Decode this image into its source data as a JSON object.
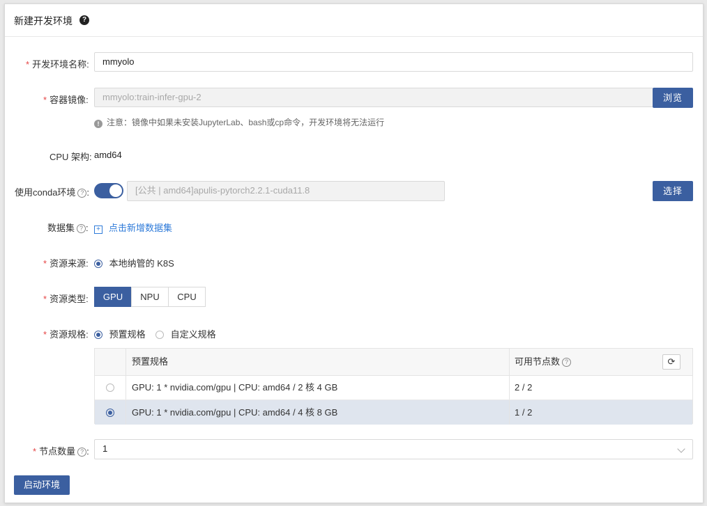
{
  "header": {
    "title": "新建开发环境",
    "help": "?"
  },
  "env_name": {
    "label": "开发环境名称:",
    "value": "mmyolo"
  },
  "image": {
    "label": "容器镜像:",
    "value": "mmyolo:train-infer-gpu-2",
    "browse_label": "浏览",
    "note": "注意：镜像中如果未安装JupyterLab、bash或cp命令，开发环境将无法运行"
  },
  "cpu_arch": {
    "label": "CPU 架构:",
    "value": "amd64"
  },
  "conda": {
    "label": "使用conda环境",
    "enabled": true,
    "value": "[公共 | amd64]apulis-pytorch2.2.1-cuda11.8",
    "select_label": "选择"
  },
  "dataset": {
    "label": "数据集",
    "link": "点击新增数据集"
  },
  "resource_source": {
    "label": "资源来源:",
    "option": "本地纳管的 K8S"
  },
  "resource_type": {
    "label": "资源类型:",
    "options": [
      "GPU",
      "NPU",
      "CPU"
    ],
    "selected": "GPU"
  },
  "resource_spec": {
    "label": "资源规格:",
    "options": [
      "预置规格",
      "自定义规格"
    ],
    "selected": "预置规格"
  },
  "spec_table": {
    "headers": [
      "预置规格",
      "可用节点数"
    ],
    "rows": [
      {
        "spec": "GPU: 1 * nvidia.com/gpu | CPU: amd64 / 2 核 4 GB",
        "nodes": "2 / 2",
        "selected": false
      },
      {
        "spec": "GPU: 1 * nvidia.com/gpu | CPU: amd64 / 4 核 8 GB",
        "nodes": "1 / 2",
        "selected": true
      }
    ]
  },
  "node_count": {
    "label": "节点数量",
    "value": "1"
  },
  "start_label": "启动环境",
  "colors": {
    "primary": "#3b5fa0",
    "required": "#e54545",
    "link": "#2f7bd9"
  }
}
